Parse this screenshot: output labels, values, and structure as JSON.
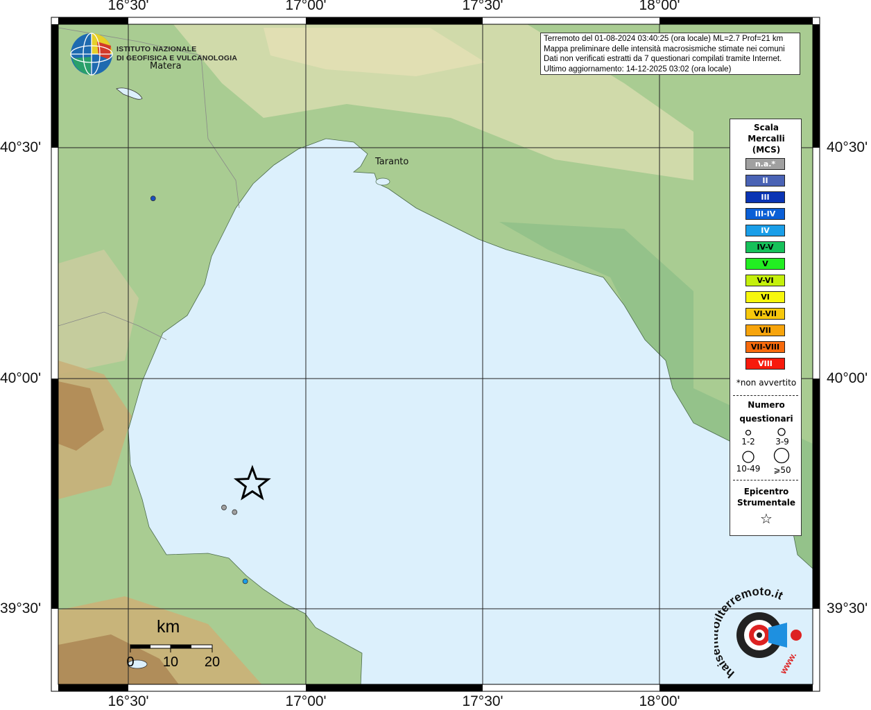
{
  "map": {
    "lon_labels": [
      "16°30'",
      "17°00'",
      "17°30'",
      "18°00'"
    ],
    "lat_labels": [
      "40°30'",
      "40°00'",
      "39°30'"
    ],
    "cities": [
      "Matera",
      "Taranto"
    ],
    "scale_bar": {
      "title": "km",
      "ticks": [
        "0",
        "10",
        "20"
      ]
    }
  },
  "logo": {
    "line1": "ISTITUTO NAZIONALE",
    "line2": "DI GEOFISICA E VULCANOLOGIA"
  },
  "info": {
    "line1": "Terremoto del 01-08-2024 03:40:25 (ora locale) ML=2.7 Prof=21 km",
    "line2": "Mappa preliminare delle intensità macrosismiche stimate nei comuni",
    "line3": "Dati non verificati estratti da 7 questionari compilati tramite Internet.",
    "line4": "Ultimo aggiornamento: 14-12-2025 03:02 (ora locale)"
  },
  "legend": {
    "title1": "Scala",
    "title2": "Mercalli",
    "title3": "(MCS)",
    "items": [
      {
        "label": "n.a.*",
        "color": "#a0a0a0",
        "text_color": "#ffffff"
      },
      {
        "label": "II",
        "color": "#4a63b5",
        "text_color": "#ffffff"
      },
      {
        "label": "III",
        "color": "#0a34b4",
        "text_color": "#ffffff"
      },
      {
        "label": "III-IV",
        "color": "#0b5fd6",
        "text_color": "#ffffff"
      },
      {
        "label": "IV",
        "color": "#1a9ee8",
        "text_color": "#ffffff"
      },
      {
        "label": "IV-V",
        "color": "#16c15a",
        "text_color": "#000000"
      },
      {
        "label": "V",
        "color": "#22ee22",
        "text_color": "#000000"
      },
      {
        "label": "V-VI",
        "color": "#c4f00c",
        "text_color": "#000000"
      },
      {
        "label": "VI",
        "color": "#f7f70c",
        "text_color": "#000000"
      },
      {
        "label": "VI-VII",
        "color": "#f7c80c",
        "text_color": "#000000"
      },
      {
        "label": "VII",
        "color": "#f7a40c",
        "text_color": "#000000"
      },
      {
        "label": "VII-VIII",
        "color": "#f76a0c",
        "text_color": "#000000"
      },
      {
        "label": "VIII",
        "color": "#f71a0c",
        "text_color": "#ffffff"
      }
    ],
    "not_felt_note": "*non avvertito",
    "count_title1": "Numero",
    "count_title2": "questionari",
    "count_labels": [
      "1-2",
      "3-9",
      "10-49",
      "⩾50"
    ],
    "epicenter_title1": "Epicentro",
    "epicenter_title2": "Strumentale"
  },
  "badge": {
    "text": "haisentitoilterremoto.it",
    "url_text": "www."
  },
  "observations": [
    {
      "lon": 16.57,
      "lat": 40.39,
      "color": "#1a4fc0"
    },
    {
      "lon": 16.77,
      "lat": 39.72,
      "color": "#a0a0a0"
    },
    {
      "lon": 16.8,
      "lat": 39.71,
      "color": "#a0a0a0"
    },
    {
      "lon": 16.83,
      "lat": 39.56,
      "color": "#1a9ee8"
    }
  ],
  "epicenter": {
    "lon": 16.85,
    "lat": 39.77
  }
}
